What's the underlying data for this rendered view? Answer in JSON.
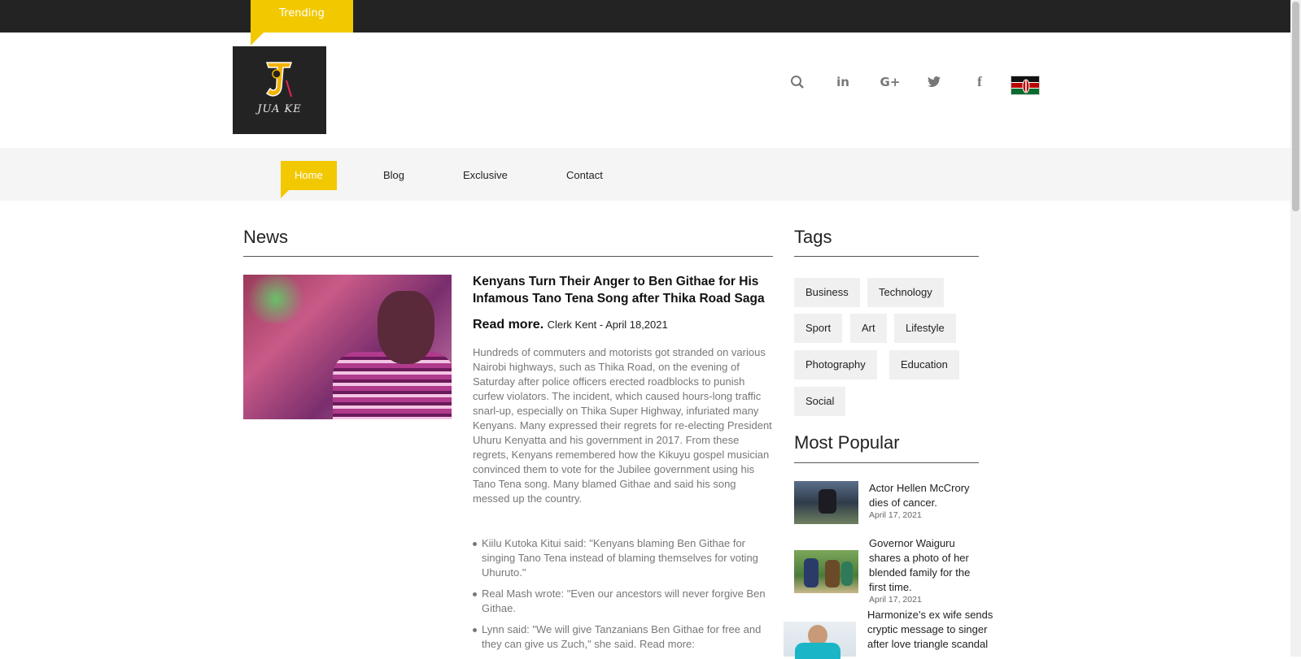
{
  "topbar": {
    "trending_label": "Trending"
  },
  "logo": {
    "text": "JUA KE"
  },
  "header_icons": [
    "search-icon",
    "linkedin-icon",
    "google-plus-icon",
    "twitter-icon",
    "facebook-icon",
    "kenya-flag-icon"
  ],
  "nav": {
    "items": [
      {
        "label": "Home",
        "active": true
      },
      {
        "label": "Blog",
        "active": false
      },
      {
        "label": "Exclusive",
        "active": false
      },
      {
        "label": "Contact",
        "active": false
      }
    ]
  },
  "accent_color": "#f2c800",
  "news": {
    "section_title": "News",
    "article": {
      "title": "Kenyans Turn Their Anger to Ben Githae for His Infamous Tano Tena Song after Thika Road Saga",
      "read_more": "Read more.",
      "byline": "Clerk Kent - April 18,2021",
      "body": "Hundreds of commuters and motorists got stranded on various Nairobi highways, such as Thika Road, on the evening of Saturday after police officers erected roadblocks to punish curfew violators. The incident, which caused hours-long traffic snarl-up, especially on Thika Super Highway, infuriated many Kenyans. Many expressed their regrets for re-electing President Uhuru Kenyatta and his government in 2017. From these regrets, Kenyans remembered how the Kikuyu gospel musician convinced them to vote for the Jubilee government using his Tano Tena song. Many blamed Githae and said his song messed up the country.",
      "quotes": [
        "Kiilu Kutoka Kitui said: \"Kenyans blaming Ben Githae for singing Tano Tena instead of blaming themselves for voting Uhuruto.\"",
        "Real Mash wrote: \"Even our ancestors will never forgive Ben Githae.",
        "Lynn said: \"We will give Tanzanians Ben Githae for free and they can give us Zuch,\" she said. Read more:"
      ]
    }
  },
  "tags": {
    "section_title": "Tags",
    "items": [
      "Business",
      "Technology",
      "Sport",
      "Art",
      "Lifestyle",
      "Photography",
      "Education",
      "Social"
    ]
  },
  "popular": {
    "section_title": "Most Popular",
    "items": [
      {
        "title": "Actor Hellen McCrory dies of cancer.",
        "date": "April 17, 2021"
      },
      {
        "title": "Governor Waiguru shares a photo of her blended family for the first time.",
        "date": "April 17, 2021"
      },
      {
        "title": "Harmonize’s ex wife sends cryptic message to singer after love triangle scandal",
        "date": ""
      }
    ]
  }
}
